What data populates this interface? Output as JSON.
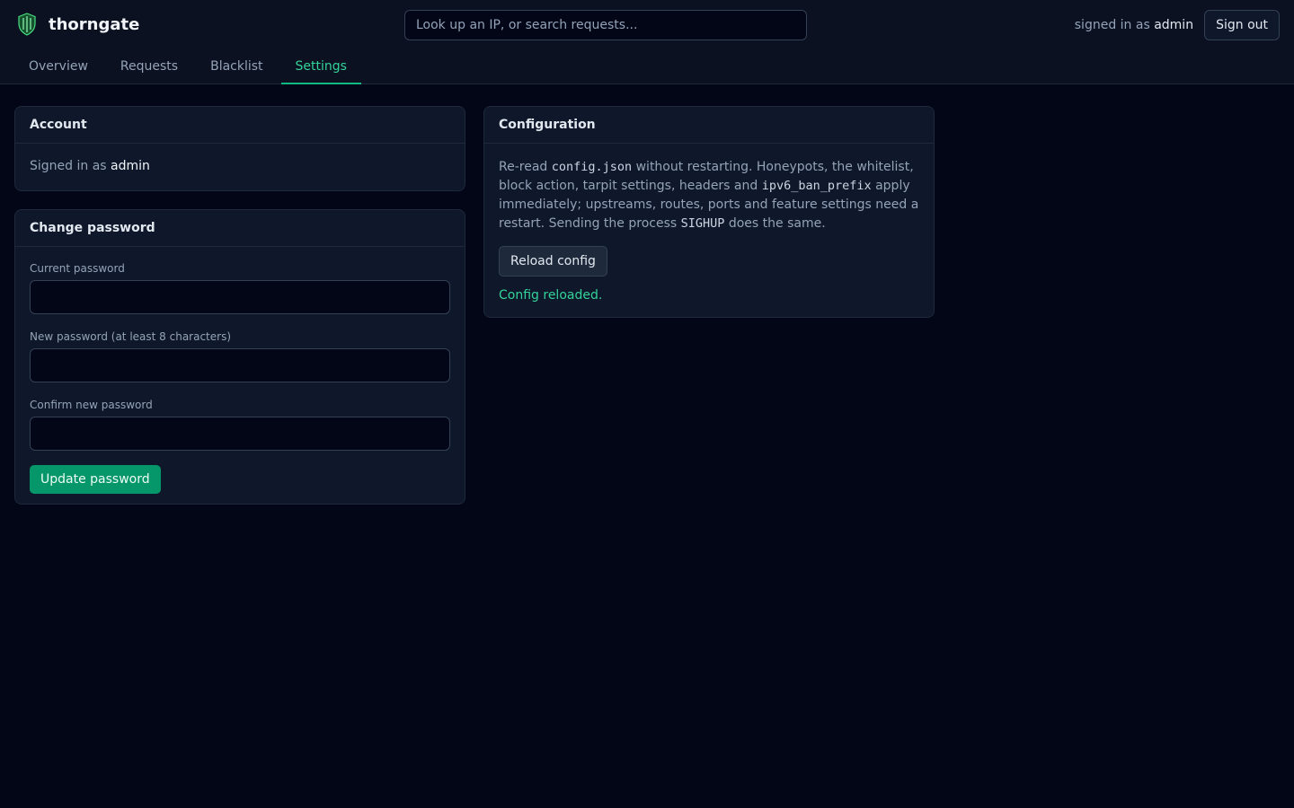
{
  "app": {
    "name": "thorngate"
  },
  "search": {
    "placeholder": "Look up an IP, or search requests..."
  },
  "user": {
    "prefix": "signed in as",
    "name": "admin",
    "signout_label": "Sign out"
  },
  "tabs": [
    {
      "label": "Overview",
      "active": false
    },
    {
      "label": "Requests",
      "active": false
    },
    {
      "label": "Blacklist",
      "active": false
    },
    {
      "label": "Settings",
      "active": true
    }
  ],
  "account": {
    "title": "Account",
    "prefix": "Signed in as",
    "user": "admin"
  },
  "password": {
    "title": "Change password",
    "current_label": "Current password",
    "new_label": "New password (at least 8 characters)",
    "confirm_label": "Confirm new password",
    "submit_label": "Update password"
  },
  "config": {
    "title": "Configuration",
    "desc_1": "Re-read ",
    "code_1": "config.json",
    "desc_2": " without restarting. Honeypots, the whitelist, block action, tarpit settings, headers and ",
    "code_2": "ipv6_ban_prefix",
    "desc_3": " apply immediately; upstreams, routes, ports and feature settings need a restart. Sending the process ",
    "code_3": "SIGHUP",
    "desc_4": " does the same.",
    "reload_label": "Reload config",
    "status": "Config reloaded."
  },
  "colors": {
    "accent": "#10b981",
    "accent_text": "#34d399",
    "bg": "#020617",
    "card": "#0f172a"
  }
}
